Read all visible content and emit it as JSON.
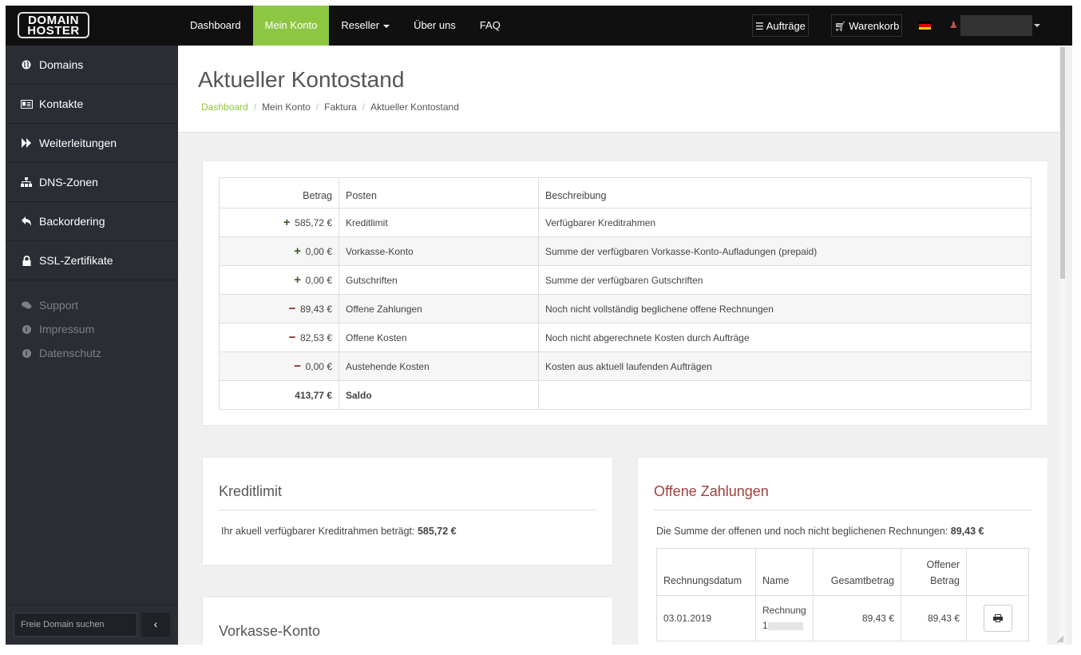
{
  "logo": {
    "line1": "DOMAIN",
    "line2": "HOSTER"
  },
  "nav": [
    {
      "label": "Dashboard",
      "active": false
    },
    {
      "label": "Mein Konto",
      "active": true
    },
    {
      "label": "Reseller",
      "active": false,
      "dropdown": true
    },
    {
      "label": "Über uns",
      "active": false
    },
    {
      "label": "FAQ",
      "active": false
    }
  ],
  "topbar": {
    "orders_label": "Aufträge",
    "cart_label": "Warenkorb"
  },
  "sidebar": {
    "items": [
      {
        "label": "Domains",
        "icon": "globe-icon"
      },
      {
        "label": "Kontakte",
        "icon": "address-card-icon"
      },
      {
        "label": "Weiterleitungen",
        "icon": "forward-icon"
      },
      {
        "label": "DNS-Zonen",
        "icon": "sitemap-icon"
      },
      {
        "label": "Backordering",
        "icon": "reply-icon"
      },
      {
        "label": "SSL-Zertifikate",
        "icon": "lock-icon"
      }
    ],
    "secondary": [
      {
        "label": "Support",
        "icon": "comments-icon"
      },
      {
        "label": "Impressum",
        "icon": "info-icon"
      },
      {
        "label": "Datenschutz",
        "icon": "info-icon"
      }
    ],
    "search_label": "Freie Domain suchen"
  },
  "page": {
    "title": "Aktueller Kontostand",
    "breadcrumb": [
      "Dashboard",
      "Mein Konto",
      "Faktura",
      "Aktueller Kontostand"
    ]
  },
  "balance_table": {
    "headers": [
      "Betrag",
      "Posten",
      "Beschreibung"
    ],
    "rows": [
      {
        "sign": "+",
        "amount": "585,72 €",
        "item": "Kreditlimit",
        "desc": "Verfügbarer Kreditrahmen"
      },
      {
        "sign": "+",
        "amount": "0,00 €",
        "item": "Vorkasse-Konto",
        "desc": "Summe der verfügbaren Vorkasse-Konto-Aufladungen (prepaid)"
      },
      {
        "sign": "+",
        "amount": "0,00 €",
        "item": "Gutschriften",
        "desc": "Summe der verfügbaren Gutschriften"
      },
      {
        "sign": "−",
        "amount": "89,43 €",
        "item": "Offene Zahlungen",
        "desc": "Noch nicht vollständig beglichene offene Rechnungen"
      },
      {
        "sign": "−",
        "amount": "82,53 €",
        "item": "Offene Kosten",
        "desc": "Noch nicht abgerechnete Kosten durch Aufträge"
      },
      {
        "sign": "−",
        "amount": "0,00 €",
        "item": "Austehende Kosten",
        "desc": "Kosten aus aktuell laufenden Aufträgen"
      }
    ],
    "total": {
      "amount": "413,77 €",
      "label": "Saldo"
    }
  },
  "credit_card": {
    "title": "Kreditlimit",
    "text": "Ihr akuell verfügbarer Kreditrahmen beträgt: ",
    "value": "585,72 €"
  },
  "prepaid_card": {
    "title": "Vorkasse-Konto"
  },
  "open_payments": {
    "title": "Offene Zahlungen",
    "text": "Die Summe der offenen und noch nicht beglichenen Rechnungen: ",
    "value": "89,43 €",
    "headers": {
      "date": "Rechnungsdatum",
      "name": "Name",
      "total": "Gesamtbetrag",
      "open_1": "Offener",
      "open_2": "Betrag"
    },
    "rows": [
      {
        "date": "03.01.2019",
        "name": "Rechnung",
        "name_2": "1",
        "total": "89,43 €",
        "open": "89,43 €"
      }
    ]
  },
  "colors": {
    "accent": "#8dc641",
    "sidebar": "#2a2d33",
    "topbar": "#101010",
    "danger_title": "#a04040"
  }
}
